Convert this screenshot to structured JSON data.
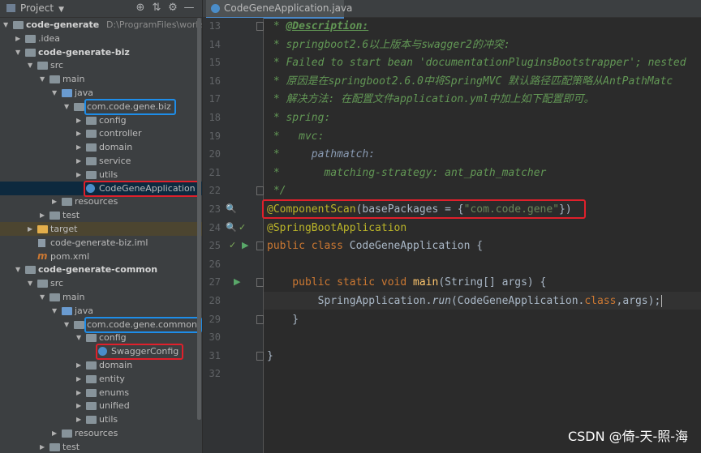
{
  "project_panel": {
    "title": "Project",
    "toolbar_icons": [
      "target-icon",
      "collapse-icon",
      "gear-icon",
      "hide-icon"
    ]
  },
  "tree": [
    {
      "label": "code-generate",
      "sublabel": "D:\\ProgramFiles\\workspace\\mys",
      "bold": true,
      "depth": 0,
      "arrow": "open",
      "icon": "module"
    },
    {
      "label": ".idea",
      "depth": 1,
      "arrow": "closed",
      "icon": "folder"
    },
    {
      "label": "code-generate-biz",
      "bold": true,
      "depth": 1,
      "arrow": "open",
      "icon": "module"
    },
    {
      "label": "src",
      "depth": 2,
      "arrow": "open",
      "icon": "folder"
    },
    {
      "label": "main",
      "depth": 3,
      "arrow": "open",
      "icon": "folder"
    },
    {
      "label": "java",
      "depth": 4,
      "arrow": "open",
      "icon": "src-folder"
    },
    {
      "label": "com.code.gene.biz",
      "depth": 5,
      "arrow": "open",
      "icon": "package",
      "highlight": "blue"
    },
    {
      "label": "config",
      "depth": 6,
      "arrow": "closed",
      "icon": "package"
    },
    {
      "label": "controller",
      "depth": 6,
      "arrow": "closed",
      "icon": "package"
    },
    {
      "label": "domain",
      "depth": 6,
      "arrow": "closed",
      "icon": "package"
    },
    {
      "label": "service",
      "depth": 6,
      "arrow": "closed",
      "icon": "package"
    },
    {
      "label": "utils",
      "depth": 6,
      "arrow": "closed",
      "icon": "package"
    },
    {
      "label": "CodeGeneApplication",
      "depth": 6,
      "arrow": "none",
      "icon": "java-class",
      "highlight": "red",
      "selected": true
    },
    {
      "label": "resources",
      "depth": 4,
      "arrow": "closed",
      "icon": "folder"
    },
    {
      "label": "test",
      "depth": 3,
      "arrow": "closed",
      "icon": "folder"
    },
    {
      "label": "target",
      "depth": 2,
      "arrow": "closed",
      "icon": "target-folder",
      "target": true
    },
    {
      "label": "code-generate-biz.iml",
      "depth": 2,
      "arrow": "none",
      "icon": "iml-file"
    },
    {
      "label": "pom.xml",
      "depth": 2,
      "arrow": "none",
      "icon": "maven-file"
    },
    {
      "label": "code-generate-common",
      "bold": true,
      "depth": 1,
      "arrow": "open",
      "icon": "module"
    },
    {
      "label": "src",
      "depth": 2,
      "arrow": "open",
      "icon": "folder"
    },
    {
      "label": "main",
      "depth": 3,
      "arrow": "open",
      "icon": "folder"
    },
    {
      "label": "java",
      "depth": 4,
      "arrow": "open",
      "icon": "src-folder"
    },
    {
      "label": "com.code.gene.common",
      "depth": 5,
      "arrow": "open",
      "icon": "package",
      "highlight": "blue"
    },
    {
      "label": "config",
      "depth": 6,
      "arrow": "open",
      "icon": "package"
    },
    {
      "label": "SwaggerConfig",
      "depth": 7,
      "arrow": "none",
      "icon": "java-class",
      "highlight": "red"
    },
    {
      "label": "domain",
      "depth": 6,
      "arrow": "closed",
      "icon": "package"
    },
    {
      "label": "entity",
      "depth": 6,
      "arrow": "closed",
      "icon": "package"
    },
    {
      "label": "enums",
      "depth": 6,
      "arrow": "closed",
      "icon": "package"
    },
    {
      "label": "unified",
      "depth": 6,
      "arrow": "closed",
      "icon": "package"
    },
    {
      "label": "utils",
      "depth": 6,
      "arrow": "closed",
      "icon": "package"
    },
    {
      "label": "resources",
      "depth": 4,
      "arrow": "closed",
      "icon": "folder"
    },
    {
      "label": "test",
      "depth": 3,
      "arrow": "closed",
      "icon": "folder"
    }
  ],
  "editor": {
    "tab_label": "CodeGeneApplication.java",
    "current_line": 28,
    "lines": [
      {
        "n": "13",
        "parts": [
          [
            "cm",
            " * "
          ],
          [
            "cmtag",
            "@Description:"
          ]
        ]
      },
      {
        "n": "14",
        "parts": [
          [
            "cm",
            " * springboot2.6以上版本与swagger2的冲突:"
          ]
        ]
      },
      {
        "n": "15",
        "parts": [
          [
            "cm",
            " * Failed to start bean 'documentationPluginsBootstrapper'; nested"
          ]
        ]
      },
      {
        "n": "16",
        "parts": [
          [
            "cm",
            " * 原因是在springboot2.6.0中将SpringMVC 默认路径匹配策略从AntPathMatc"
          ]
        ]
      },
      {
        "n": "17",
        "parts": [
          [
            "cm",
            " * 解决方法: 在配置文件application.yml中加上如下配置即可。"
          ]
        ]
      },
      {
        "n": "18",
        "parts": [
          [
            "cm",
            " * spring:"
          ]
        ]
      },
      {
        "n": "19",
        "parts": [
          [
            "cm",
            " *   mvc:"
          ]
        ]
      },
      {
        "n": "20",
        "parts": [
          [
            "cm",
            " *     "
          ],
          [
            "cmkey",
            "pathmatch:"
          ]
        ]
      },
      {
        "n": "21",
        "parts": [
          [
            "cm",
            " *       matching-strategy: ant_path_matcher"
          ]
        ]
      },
      {
        "n": "22",
        "parts": [
          [
            "cm",
            " */"
          ]
        ]
      },
      {
        "n": "23",
        "parts": [
          [
            "ann",
            "@ComponentScan"
          ],
          [
            "pl",
            "(basePackages = {"
          ],
          [
            "st",
            "\"com.code.gene\""
          ],
          [
            "pl",
            "})"
          ]
        ]
      },
      {
        "n": "24",
        "parts": [
          [
            "ann",
            "@SpringBootApplication"
          ]
        ]
      },
      {
        "n": "25",
        "parts": [
          [
            "kw",
            "public class "
          ],
          [
            "pl",
            "CodeGeneApplication {"
          ]
        ]
      },
      {
        "n": "26",
        "parts": []
      },
      {
        "n": "27",
        "parts": [
          [
            "kw",
            "    public static void "
          ],
          [
            "fn",
            "main"
          ],
          [
            "pl",
            "(String[] args) {"
          ]
        ]
      },
      {
        "n": "28",
        "parts": [
          [
            "pl",
            "        SpringApplication."
          ],
          [
            "itpl",
            "run"
          ],
          [
            "pl",
            "(CodeGeneApplication."
          ],
          [
            "kw",
            "class"
          ],
          [
            "pl",
            ",args);"
          ]
        ]
      },
      {
        "n": "29",
        "parts": [
          [
            "pl",
            "    }"
          ]
        ]
      },
      {
        "n": "30",
        "parts": []
      },
      {
        "n": "31",
        "parts": [
          [
            "pl",
            "}"
          ]
        ]
      },
      {
        "n": "32",
        "parts": []
      }
    ]
  },
  "watermark": "CSDN @倚-天-照-海"
}
